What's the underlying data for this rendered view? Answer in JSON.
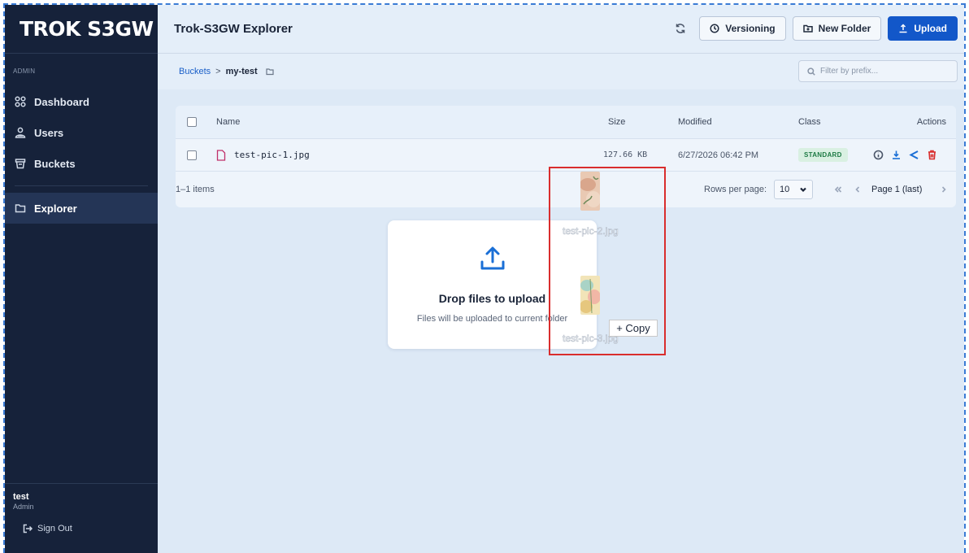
{
  "brand": "TROK S3GW",
  "sidebar": {
    "section_label": "ADMIN",
    "items": [
      {
        "label": "Dashboard",
        "icon": "grid-icon"
      },
      {
        "label": "Users",
        "icon": "users-icon"
      },
      {
        "label": "Buckets",
        "icon": "bucket-icon"
      },
      {
        "label": "Explorer",
        "icon": "folder-icon",
        "active": true
      }
    ],
    "user": {
      "name": "test",
      "role": "Admin"
    },
    "signout_label": "Sign Out"
  },
  "header": {
    "title": "Trok-S3GW Explorer",
    "versioning_label": "Versioning",
    "new_folder_label": "New Folder",
    "upload_label": "Upload"
  },
  "breadcrumb": {
    "root": "Buckets",
    "separator": ">",
    "current": "my-test"
  },
  "filter": {
    "placeholder": "Filter by prefix..."
  },
  "table": {
    "columns": {
      "name": "Name",
      "size": "Size",
      "modified": "Modified",
      "class": "Class",
      "actions": "Actions"
    },
    "rows": [
      {
        "name": "test-pic-1.jpg",
        "size": "127.66 KB",
        "modified": "6/27/2026 06:42 PM",
        "class": "STANDARD"
      }
    ],
    "footer": {
      "count": "1–1 items",
      "rows_per_page_label": "Rows per page:",
      "rows_per_page": "10",
      "page_label": "Page 1 (last)"
    }
  },
  "dropzone": {
    "title": "Drop files to upload",
    "subtitle": "Files will be uploaded to current folder"
  },
  "drag": {
    "files": [
      "test-pic-2.jpg",
      "test-pic-3.jpg"
    ],
    "copy_label": "+ Copy"
  },
  "colors": {
    "sidebar_bg": "#16223a",
    "main_bg": "#dde9f6",
    "primary": "#1257c9",
    "badge_bg": "#d9f0e2",
    "badge_text": "#1d7a44",
    "delete": "#d92d2d",
    "drag_highlight": "#d92d2d"
  }
}
